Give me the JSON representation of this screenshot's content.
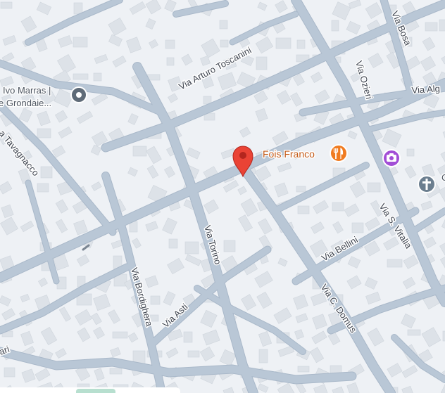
{
  "map": {
    "colors": {
      "background": "#eef1f5",
      "road": "#b9c7d6",
      "road_casing": "#a9b8c9",
      "building": "#dde2e8",
      "building_edge": "#cfd5dc",
      "pin": "#ea4335",
      "restaurant": "#f07b20",
      "photo": "#a24ed6",
      "church": "#6b7e8f",
      "landmark": "#5f6b78"
    },
    "streets": [
      {
        "id": "arturo-toscanini",
        "label": "Via Arturo Toscanini"
      },
      {
        "id": "bosa",
        "label": "Via Bosa"
      },
      {
        "id": "ozieri",
        "label": "Via Ozieri"
      },
      {
        "id": "alg",
        "label": "Via Alg"
      },
      {
        "id": "tavagnacco",
        "label": "a Tavagnacco"
      },
      {
        "id": "torino",
        "label": "Via Torino"
      },
      {
        "id": "bordighera",
        "label": "Via Bordighera"
      },
      {
        "id": "asti",
        "label": "Via Asti"
      },
      {
        "id": "c-domus",
        "label": "Via C. Domus"
      },
      {
        "id": "bellini",
        "label": "Via Bellini"
      },
      {
        "id": "s-vitalia",
        "label": "Via S. Vitalia"
      },
      {
        "id": "iari",
        "label": "iari"
      }
    ],
    "pois": {
      "ivo_marras_line1": "Ivo Marras |",
      "ivo_marras_line2": "e Grondaie...",
      "fois_franco": "Fois Franco",
      "edge_letter": "C"
    },
    "icons": {
      "pin": "location-pin-icon",
      "restaurant": "fork-knife-icon",
      "photo": "camera-icon",
      "church": "church-cross-icon",
      "landmark": "landmark-dot-icon"
    }
  }
}
